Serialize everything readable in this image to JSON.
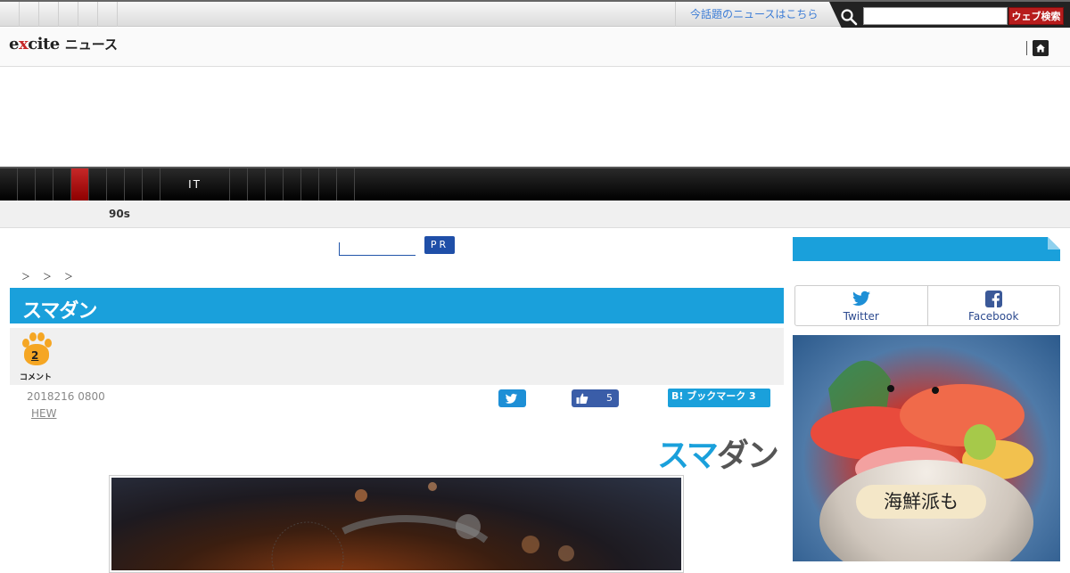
{
  "topbar": {
    "trend_link": "今話題のニュースはこちら",
    "search_placeholder": "",
    "search_button": "ウェブ検索"
  },
  "header": {
    "logo_text_a": "e",
    "logo_text_x": "x",
    "logo_text_b": "cite",
    "logo_section": "ニュース"
  },
  "nav": {
    "it_label": "IT",
    "sub_item": "90s"
  },
  "pr": {
    "badge": "PR"
  },
  "breadcrumb": "＞＞＞",
  "article": {
    "brand_banner": "スマダン",
    "comment_count": "2",
    "comment_label": "コメント",
    "date": "2018216 0800",
    "author": "HEW",
    "like_count": "5",
    "hatena_label": "B! ブックマーク 3",
    "brand_big_a": "スマ",
    "brand_big_b": "ダン"
  },
  "sidebar": {
    "twitter": "Twitter",
    "facebook": "Facebook",
    "ad_caption": "海鮮派も"
  },
  "colors": {
    "accent": "#1aa0db",
    "brand_red": "#c62828",
    "nav_bg": "#000000"
  }
}
